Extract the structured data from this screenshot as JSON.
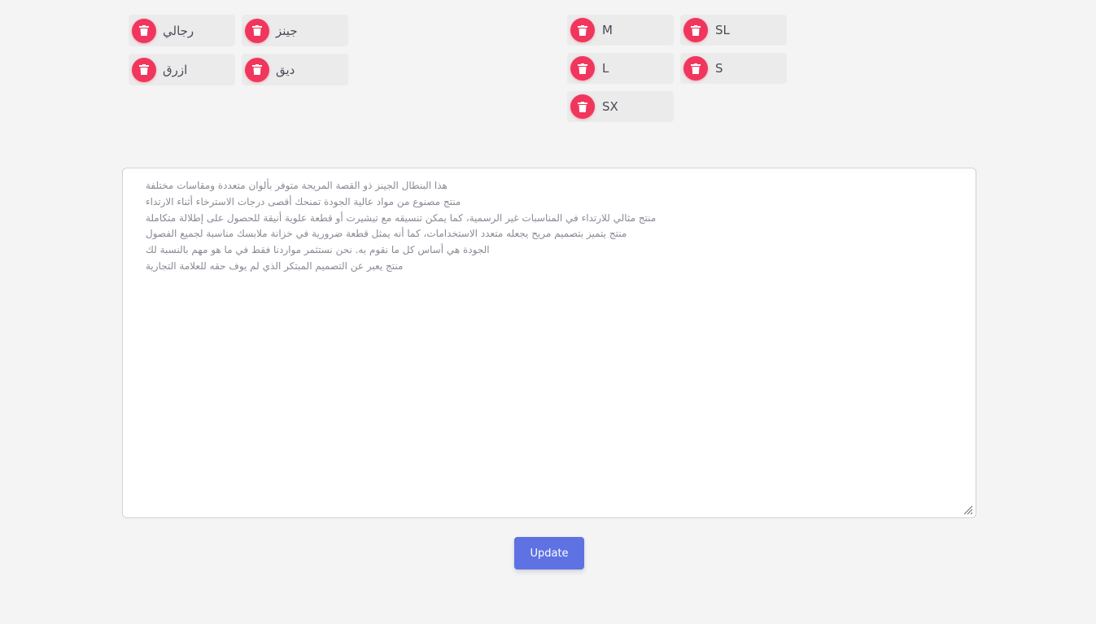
{
  "left_tags": [
    {
      "label": "رجالي"
    },
    {
      "label": "جينز"
    },
    {
      "label": "ازرق"
    },
    {
      "label": "ديق"
    }
  ],
  "right_tags": [
    {
      "label": "M"
    },
    {
      "label": "SL"
    },
    {
      "label": "L"
    },
    {
      "label": "S"
    },
    {
      "label": "SX"
    }
  ],
  "delete_icon": "trash-icon",
  "description": "هذا البنطال الجينز ذو القصة المريحة متوفر بألوان متعددة ومقاسات مختلفة\nمنتج مصنوع من مواد عالية الجودة تمنحك أقصى درجات الاسترخاء أثناء الارتداء\nمنتج مثالي للارتداء في المناسبات غير الرسمية، كما يمكن تنسيقه مع تيشيرت أو قطعة علوية أنيقة للحصول على إطلالة متكاملة\nمنتج يتميز بتصميم مريح يجعله متعدد الاستخدامات، كما أنه يمثل قطعة ضرورية في خزانة ملابسك مناسبة لجميع الفصول\nالجودة هي أساس كل ما نقوم به. نحن نستثمر مواردنا فقط في ما هو مهم بالنسبة لك\nمنتج يعبر عن التصميم المبتكر الذي لم يوف حقه للعلامة التجارية",
  "update_label": "Update",
  "colors": {
    "delete_button": "#f1365d",
    "update_button": "#5e72e4",
    "background": "#f4f4f5",
    "tag_background": "#ebebeb"
  }
}
